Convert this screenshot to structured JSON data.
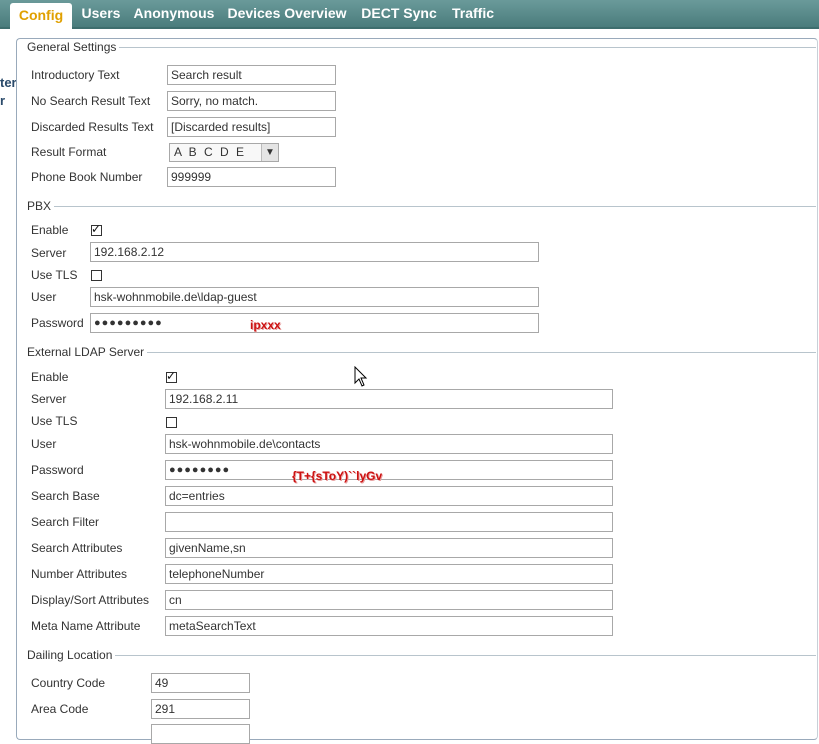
{
  "tabs": [
    {
      "label": "Config",
      "active": true
    },
    {
      "label": "Users"
    },
    {
      "label": "Anonymous"
    },
    {
      "label": "Devices Overview"
    },
    {
      "label": "DECT Sync"
    },
    {
      "label": "Traffic"
    }
  ],
  "left_stub": [
    "ter",
    "r"
  ],
  "general": {
    "legend": "General Settings",
    "intro_label": "Introductory Text",
    "intro_value": "Search result",
    "nores_label": "No Search Result Text",
    "nores_value": "Sorry, no match.",
    "disc_label": "Discarded Results Text",
    "disc_value": "[Discarded results]",
    "format_label": "Result Format",
    "format_value": "A B C D E",
    "pbn_label": "Phone Book Number",
    "pbn_value": "999999"
  },
  "pbx": {
    "legend": "PBX",
    "enable_label": "Enable",
    "enable_checked": true,
    "server_label": "Server",
    "server_value": "192.168.2.12",
    "tls_label": "Use TLS",
    "tls_checked": false,
    "user_label": "User",
    "user_value": "hsk-wohnmobile.de\\ldap-guest",
    "password_label": "Password",
    "password_value": "●●●●●●●●●",
    "password_annotation": "ipxxx"
  },
  "ldap": {
    "legend": "External LDAP Server",
    "enable_label": "Enable",
    "enable_checked": true,
    "server_label": "Server",
    "server_value": "192.168.2.11",
    "tls_label": "Use TLS",
    "tls_checked": false,
    "user_label": "User",
    "user_value": "hsk-wohnmobile.de\\contacts",
    "password_label": "Password",
    "password_value": "●●●●●●●●",
    "password_annotation": "{T+{sToY)``lyGv",
    "base_label": "Search Base",
    "base_value": "dc=entries",
    "filter_label": "Search Filter",
    "filter_value": "",
    "attrs_label": "Search Attributes",
    "attrs_value": "givenName,sn",
    "num_label": "Number Attributes",
    "num_value": "telephoneNumber",
    "disp_label": "Display/Sort Attributes",
    "disp_value": "cn",
    "meta_label": "Meta Name Attribute",
    "meta_value": "metaSearchText"
  },
  "dialing": {
    "legend": "Dailing Location",
    "country_label": "Country Code",
    "country_value": "49",
    "area_label": "Area Code",
    "area_value": "291"
  }
}
